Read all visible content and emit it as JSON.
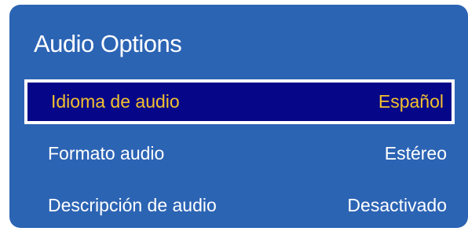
{
  "panel": {
    "title": "Audio Options"
  },
  "menu": {
    "items": [
      {
        "label": "Idioma de audio",
        "value": "Español",
        "selected": true
      },
      {
        "label": "Formato audio",
        "value": "Estéreo",
        "selected": false
      },
      {
        "label": "Descripción de audio",
        "value": "Desactivado",
        "selected": false
      }
    ]
  },
  "colors": {
    "panel_background": "#2c64b4",
    "selected_background": "#060689",
    "selected_text": "#f2c12e",
    "text": "#ffffff"
  }
}
